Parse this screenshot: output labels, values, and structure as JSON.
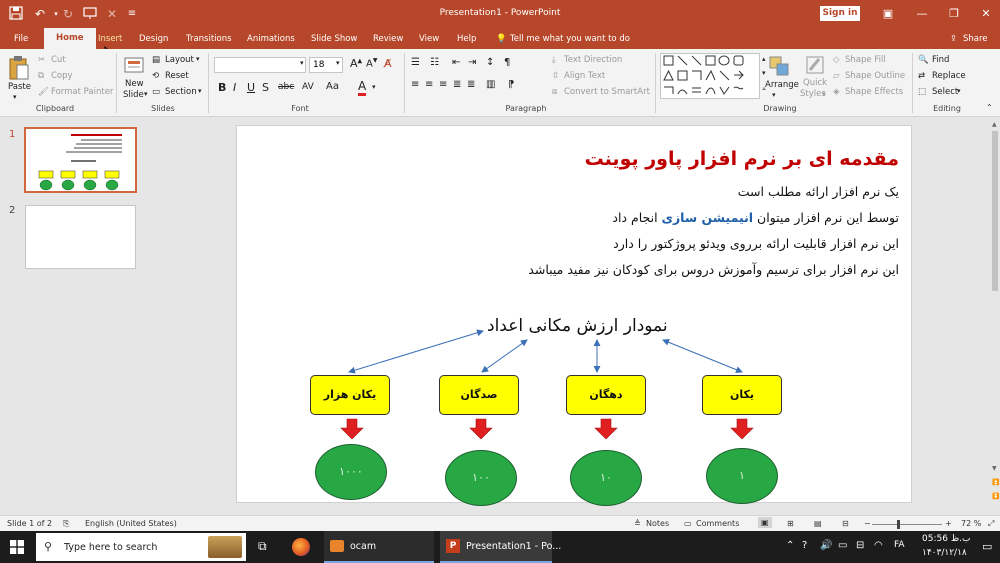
{
  "window": {
    "title": "Presentation1 - PowerPoint",
    "signin": "Sign in"
  },
  "tabs": [
    "File",
    "Home",
    "Insert",
    "Design",
    "Transitions",
    "Animations",
    "Slide Show",
    "Review",
    "View",
    "Help"
  ],
  "tell_me": "Tell me what you want to do",
  "share": "Share",
  "ribbon": {
    "clipboard": {
      "paste": "Paste",
      "cut": "Cut",
      "copy": "Copy",
      "format_painter": "Format Painter",
      "label": "Clipboard"
    },
    "slides": {
      "new_slide_1": "New",
      "new_slide_2": "Slide",
      "layout": "Layout",
      "reset": "Reset",
      "section": "Section",
      "label": "Slides"
    },
    "font": {
      "size": "18",
      "label": "Font",
      "bold": "B",
      "italic": "I",
      "underline": "U",
      "strike": "S",
      "shadow": "abc",
      "spacing": "AV",
      "case": "Aa",
      "color": "A"
    },
    "paragraph": {
      "text_direction": "Text Direction",
      "align_text": "Align Text",
      "smartart": "Convert to SmartArt",
      "label": "Paragraph"
    },
    "drawing": {
      "arrange": "Arrange",
      "quick_1": "Quick",
      "quick_2": "Styles",
      "shape_fill": "Shape Fill",
      "shape_outline": "Shape Outline",
      "shape_effects": "Shape Effects",
      "label": "Drawing"
    },
    "editing": {
      "find": "Find",
      "replace": "Replace",
      "select": "Select",
      "label": "Editing"
    }
  },
  "thumbs": [
    "1",
    "2"
  ],
  "slide": {
    "title": "مقدمه ای بر نرم افزار پاور پوینت",
    "line1": "یک نرم افزار ارائه مطلب است",
    "line2_a": "توسط این نرم افزار میتوان ",
    "line2_b": "انیمیشن سازی",
    "line2_c": " انجام داد",
    "line3": "این نرم افزار قابلیت ارائه برروی ویدئو پروژکتور را دارد",
    "line4": "این نرم افزار برای ترسیم وآموزش دروس برای کودکان نیز مفید میباشد",
    "subtitle": "نمودار ارزش مکانی اعداد",
    "boxes": [
      "یکان هزار",
      "صدگان",
      "دهگان",
      "یکان"
    ],
    "circles": [
      "۱۰۰۰",
      "۱۰۰",
      "۱۰",
      "۱"
    ]
  },
  "status": {
    "slide": "Slide 1 of 2",
    "language": "English (United States)",
    "notes": "Notes",
    "comments": "Comments",
    "zoom": "72 %"
  },
  "taskbar": {
    "search": "Type here to search",
    "app1": "ocam",
    "app2": "Presentation1 - Po...",
    "time": "05:56 ب.ظ",
    "date": "۱۴۰۳/۱۲/۱۸"
  },
  "colors": {
    "accent": "#b7472a",
    "title_red": "#c00000",
    "yellow": "#ffff00",
    "green": "#28a745",
    "arrow": "#e02020"
  }
}
